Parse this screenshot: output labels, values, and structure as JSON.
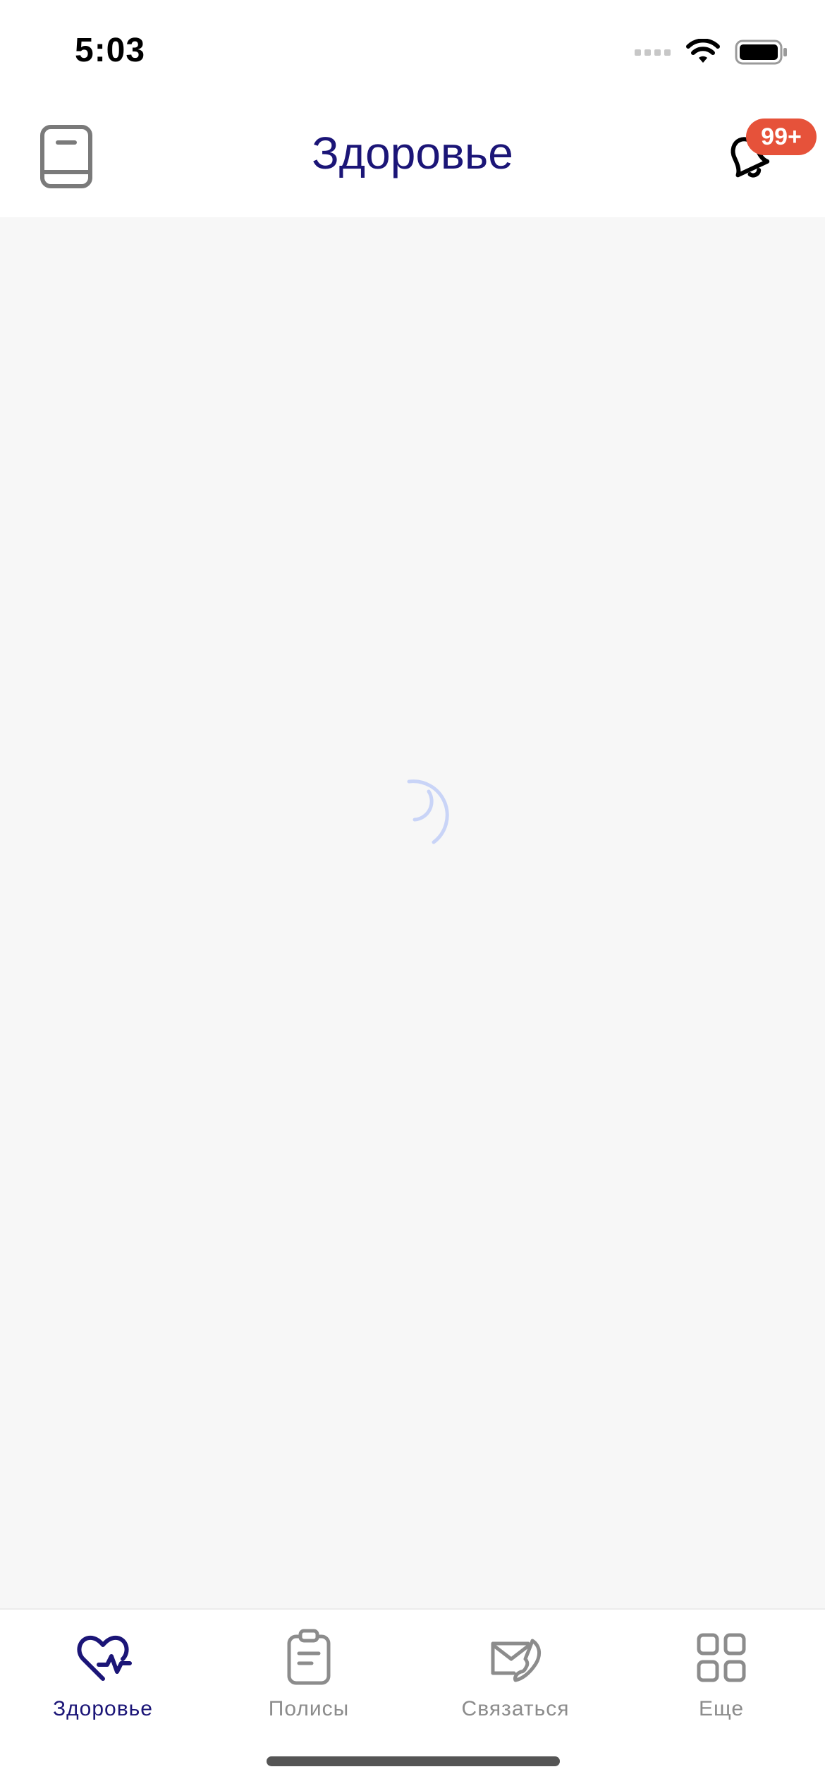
{
  "status_bar": {
    "time": "5:03"
  },
  "header": {
    "title": "Здоровье",
    "notifications_badge": "99+",
    "left_icon": "book-icon",
    "right_icon": "bell-icon"
  },
  "content": {
    "state": "loading",
    "spinner_icon": "loading-spinner-icon"
  },
  "tab_bar": {
    "tabs": [
      {
        "label": "Здоровье",
        "icon": "heart-pulse-icon",
        "active": true
      },
      {
        "label": "Полисы",
        "icon": "clipboard-icon",
        "active": false
      },
      {
        "label": "Связаться",
        "icon": "envelope-phone-icon",
        "active": false
      },
      {
        "label": "Еще",
        "icon": "grid-icon",
        "active": false
      }
    ]
  },
  "colors": {
    "accent": "#1b1577",
    "badge": "#e6523a",
    "inactive": "#8c8c8c",
    "background": "#f7f7f7",
    "spinner": "#c9d4f7"
  }
}
